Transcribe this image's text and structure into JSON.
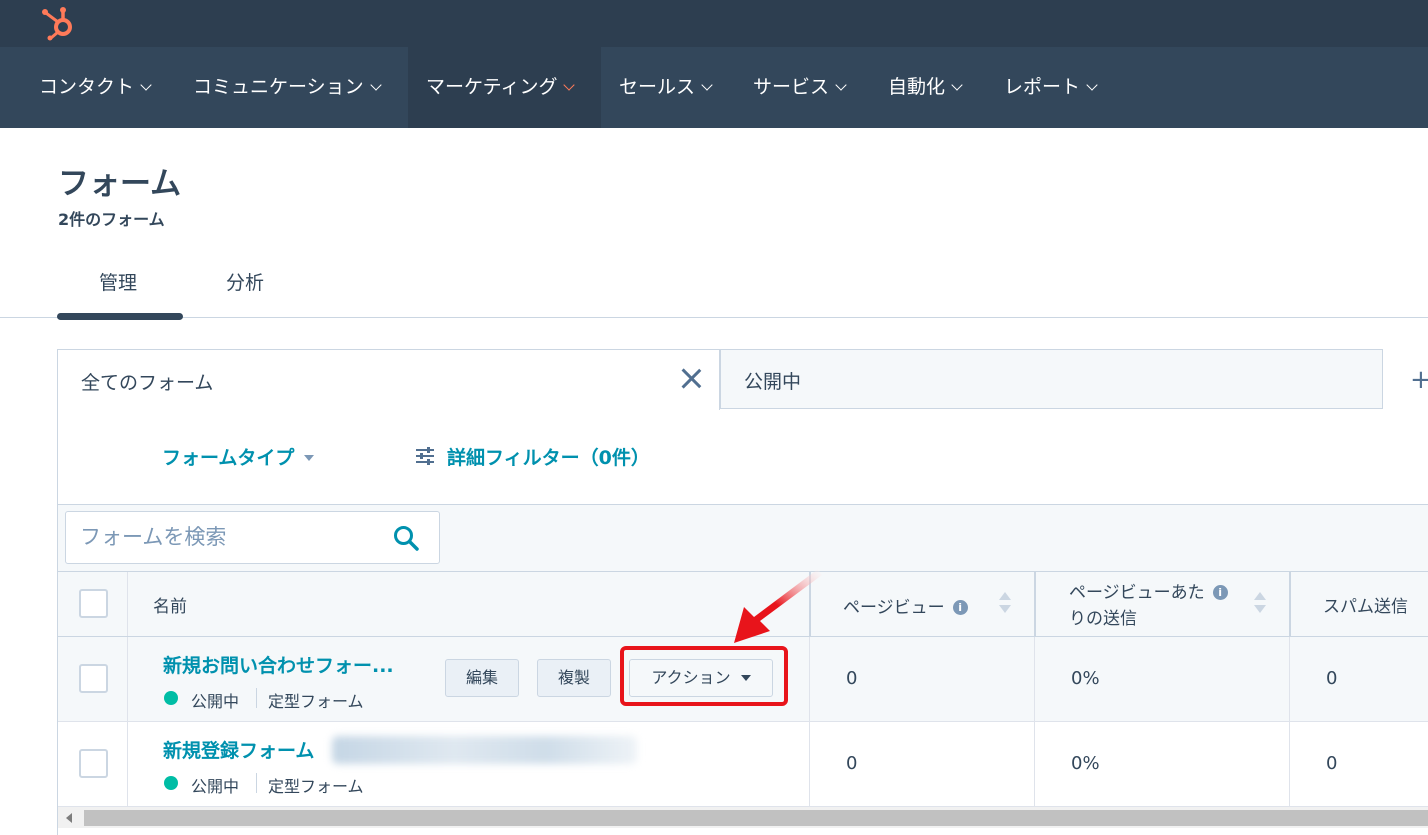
{
  "nav": {
    "items": [
      {
        "label": "コンタクト",
        "active": false
      },
      {
        "label": "コミュニケーション",
        "active": false
      },
      {
        "label": "マーケティング",
        "active": true
      },
      {
        "label": "セールス",
        "active": false
      },
      {
        "label": "サービス",
        "active": false
      },
      {
        "label": "自動化",
        "active": false
      },
      {
        "label": "レポート",
        "active": false
      }
    ]
  },
  "page": {
    "title": "フォーム",
    "subtitle": "2件のフォーム",
    "tabs": [
      "管理",
      "分析"
    ]
  },
  "views": {
    "tab1": "全てのフォーム",
    "tab2": "公開中"
  },
  "filters": {
    "form_type": "フォームタイプ",
    "advanced": "詳細フィルター（0件）"
  },
  "search": {
    "placeholder": "フォームを検索"
  },
  "table": {
    "headers": {
      "name": "名前",
      "pageviews": "ページビュー",
      "submissions_per_view_line1": "ページビューあた",
      "submissions_per_view_line2": "りの送信",
      "spam": "スパム送信"
    },
    "rows": [
      {
        "name": "新規お問い合わせフォー...",
        "status": "公開中",
        "type": "定型フォーム",
        "pageviews": "0",
        "rate": "0%",
        "spam": "0"
      },
      {
        "name": "新規登録フォーム",
        "status": "公開中",
        "type": "定型フォーム",
        "pageviews": "0",
        "rate": "0%",
        "spam": "0"
      }
    ],
    "row_actions": {
      "edit": "編集",
      "clone": "複製",
      "actions": "アクション"
    }
  },
  "colors": {
    "nav_bg": "#33475b",
    "link": "#0091ae",
    "status_published": "#00bda5",
    "highlight": "#e8141b",
    "brand": "#ff7a59"
  }
}
